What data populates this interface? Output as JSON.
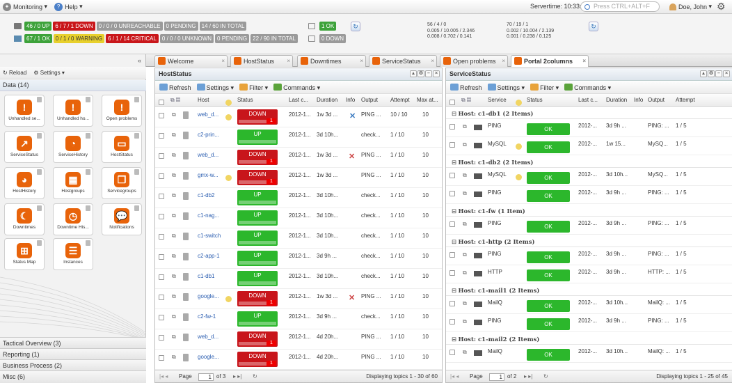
{
  "topbar": {
    "monitoring": "Monitoring",
    "help": "Help",
    "servertime": "Servertime: 10:33:53",
    "search_placeholder": "Press CTRL+ALT+F ...",
    "user": "Doe, John"
  },
  "status": {
    "hosts": [
      "46 / 0 UP",
      "6 / 7 / 1 DOWN",
      "0 / 0 / 0 UNREACHABLE",
      "0 PENDING",
      "14 / 60 IN TOTAL"
    ],
    "services": [
      "67 / 1 OK",
      "0 / 1 / 0 WARNING",
      "6 / 1 / 14 CRITICAL",
      "0 / 0 / 0 UNKNOWN",
      "0 PENDING",
      "22 / 90 IN TOTAL"
    ],
    "summary_ok": "1 OK",
    "summary_down": "0 DOWN",
    "perf1": [
      "56 / 4 / 0",
      "0.005 / 10.005 / 2.346",
      "0.008 / 0.702 / 0.141"
    ],
    "perf2": [
      "70 / 19 / 1",
      "0.002 / 10.004 / 2.139",
      "0.001 / 0.238 / 0.125"
    ]
  },
  "leftpanel": {
    "reload": "Reload",
    "settings": "Settings",
    "data_title": "Data (14)",
    "tiles": [
      "Unhandled se...",
      "Unhandled ho...",
      "Open problems",
      "ServiceStatus",
      "ServiceHistory",
      "HostStatus",
      "HostHistory",
      "Hostgroups",
      "Servicegroups",
      "Downtimes",
      "Downtime His...",
      "Notifications",
      "Status Map",
      "Instances"
    ],
    "sections": [
      "Tactical Overview (3)",
      "Reporting (1)",
      "Business Process (2)",
      "Misc (6)"
    ]
  },
  "tabs": [
    "Welcome",
    "HostStatus",
    "Downtimes",
    "ServiceStatus",
    "Open problems",
    "Portal 2columns"
  ],
  "hoststatus": {
    "title": "HostStatus",
    "toolbar": [
      "Refresh",
      "Settings",
      "Filter",
      "Commands"
    ],
    "columns": [
      "Host",
      "Status",
      "Last c...",
      "Duration",
      "Info",
      "Output",
      "Attempt",
      "Max at..."
    ],
    "rows": [
      {
        "host": "web_d...",
        "status": "DOWN",
        "last": "2012-1...",
        "dur": "1w 3d ...",
        "out": "PING ...",
        "att": "10 / 10",
        "max": "10"
      },
      {
        "host": "c2-prin...",
        "status": "UP",
        "last": "2012-1...",
        "dur": "3d 10h...",
        "out": "check...",
        "att": "1 / 10",
        "max": "10"
      },
      {
        "host": "web_d...",
        "status": "DOWN",
        "last": "2012-1...",
        "dur": "1w 3d ...",
        "out": "PING ...",
        "att": "1 / 10",
        "max": "10"
      },
      {
        "host": "gmx-w...",
        "status": "DOWN",
        "last": "2012-1...",
        "dur": "1w 3d ...",
        "out": "PING ...",
        "att": "1 / 10",
        "max": "10"
      },
      {
        "host": "c1-db2",
        "status": "UP",
        "last": "2012-1...",
        "dur": "3d 10h...",
        "out": "check...",
        "att": "1 / 10",
        "max": "10"
      },
      {
        "host": "c1-nag...",
        "status": "UP",
        "last": "2012-1...",
        "dur": "3d 10h...",
        "out": "check...",
        "att": "1 / 10",
        "max": "10"
      },
      {
        "host": "c1-switch",
        "status": "UP",
        "last": "2012-1...",
        "dur": "3d 10h...",
        "out": "check...",
        "att": "1 / 10",
        "max": "10"
      },
      {
        "host": "c2-app-1",
        "status": "UP",
        "last": "2012-1...",
        "dur": "3d 9h ...",
        "out": "check...",
        "att": "1 / 10",
        "max": "10"
      },
      {
        "host": "c1-db1",
        "status": "UP",
        "last": "2012-1...",
        "dur": "3d 10h...",
        "out": "check...",
        "att": "1 / 10",
        "max": "10"
      },
      {
        "host": "google...",
        "status": "DOWN",
        "last": "2012-1...",
        "dur": "1w 3d ...",
        "out": "PING ...",
        "att": "1 / 10",
        "max": "10"
      },
      {
        "host": "c2-fw-1",
        "status": "UP",
        "last": "2012-1...",
        "dur": "3d 9h ...",
        "out": "check...",
        "att": "1 / 10",
        "max": "10"
      },
      {
        "host": "web_d...",
        "status": "DOWN",
        "last": "2012-1...",
        "dur": "4d 20h...",
        "out": "PING ...",
        "att": "1 / 10",
        "max": "10"
      },
      {
        "host": "google...",
        "status": "DOWN",
        "last": "2012-1...",
        "dur": "4d 20h...",
        "out": "PING ...",
        "att": "1 / 10",
        "max": "10"
      }
    ],
    "page": "Page",
    "page_value": "1",
    "page_of": "of 3",
    "display": "Displaying topics 1 - 30 of 60"
  },
  "servicestatus": {
    "title": "ServiceStatus",
    "toolbar": [
      "Refresh",
      "Settings",
      "Filter",
      "Commands"
    ],
    "columns": [
      "Service",
      "Status",
      "Last c...",
      "Duration",
      "Info",
      "Output",
      "Attempt"
    ],
    "groups": [
      {
        "title": "Host: c1-db1 (2 Items)",
        "rows": [
          {
            "svc": "PING",
            "status": "OK",
            "last": "2012-...",
            "dur": "3d 9h ...",
            "out": "PING: ...",
            "att": "1 / 5"
          },
          {
            "svc": "MySQL",
            "status": "OK",
            "last": "2012-...",
            "dur": "1w 15...",
            "out": "MySQ...",
            "att": "1 / 5"
          }
        ]
      },
      {
        "title": "Host: c1-db2 (2 Items)",
        "rows": [
          {
            "svc": "MySQL",
            "status": "OK",
            "last": "2012-...",
            "dur": "3d 10h...",
            "out": "MySQ...",
            "att": "1 / 5"
          },
          {
            "svc": "PING",
            "status": "OK",
            "last": "2012-...",
            "dur": "3d 9h ...",
            "out": "PING: ...",
            "att": "1 / 5"
          }
        ]
      },
      {
        "title": "Host: c1-fw (1 Item)",
        "rows": [
          {
            "svc": "PING",
            "status": "OK",
            "last": "2012-...",
            "dur": "3d 9h ...",
            "out": "PING: ...",
            "att": "1 / 5"
          }
        ]
      },
      {
        "title": "Host: c1-http (2 Items)",
        "rows": [
          {
            "svc": "PING",
            "status": "OK",
            "last": "2012-...",
            "dur": "3d 9h ...",
            "out": "PING: ...",
            "att": "1 / 5"
          },
          {
            "svc": "HTTP",
            "status": "OK",
            "last": "2012-...",
            "dur": "3d 9h ...",
            "out": "HTTP: ...",
            "att": "1 / 5"
          }
        ]
      },
      {
        "title": "Host: c1-mail1 (2 Items)",
        "rows": [
          {
            "svc": "MailQ",
            "status": "OK",
            "last": "2012-...",
            "dur": "3d 10h...",
            "out": "MailQ: ...",
            "att": "1 / 5"
          },
          {
            "svc": "PING",
            "status": "OK",
            "last": "2012-...",
            "dur": "3d 9h ...",
            "out": "PING: ...",
            "att": "1 / 5"
          }
        ]
      },
      {
        "title": "Host: c1-mail2 (2 Items)",
        "rows": [
          {
            "svc": "MailQ",
            "status": "OK",
            "last": "2012-...",
            "dur": "3d 10h...",
            "out": "MailQ: ...",
            "att": "1 / 5"
          }
        ]
      }
    ],
    "page": "Page",
    "page_value": "1",
    "page_of": "of 2",
    "display": "Displaying topics 1 - 25 of 45"
  }
}
